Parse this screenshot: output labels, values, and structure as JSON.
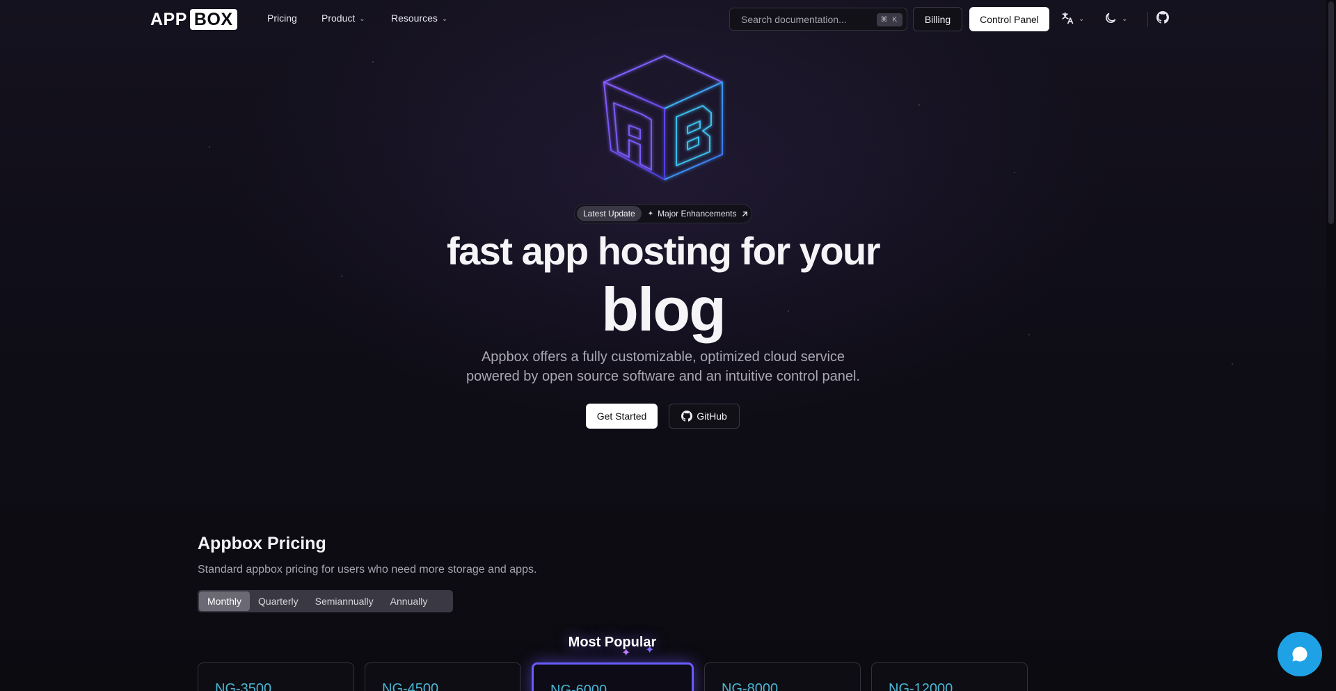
{
  "nav": {
    "logo_left": "APP",
    "logo_right": "BOX",
    "links": [
      {
        "label": "Pricing",
        "has_menu": false
      },
      {
        "label": "Product",
        "has_menu": true
      },
      {
        "label": "Resources",
        "has_menu": true
      }
    ],
    "search_placeholder": "Search documentation...",
    "search_shortcut": "⌘ K",
    "billing_label": "Billing",
    "control_panel_label": "Control Panel",
    "icons": [
      "translate-icon",
      "theme-icon",
      "github-icon"
    ]
  },
  "hero": {
    "badge_tag": "Latest Update",
    "badge_message": "Major Enhancements",
    "headline_line1": "fast app hosting for your",
    "headline_line2": "blog",
    "subtitle_line1": "Appbox offers a fully customizable, optimized cloud service",
    "subtitle_line2": "powered by open source software and an intuitive control panel.",
    "cta_primary": "Get Started",
    "cta_secondary": "GitHub"
  },
  "pricing": {
    "title": "Appbox Pricing",
    "subtitle": "Standard appbox pricing for users who need more storage and apps.",
    "periods": [
      "Monthly",
      "Quarterly",
      "Semiannually",
      "Annually"
    ],
    "active_period": "Monthly",
    "most_popular_label": "Most Popular",
    "plans": [
      "NG-3500",
      "NG-4500",
      "NG-6000",
      "NG-8000",
      "NG-12000"
    ],
    "featured_plan": "NG-6000"
  },
  "colors": {
    "background": "#0d0c12",
    "accent_cyan": "#4ab7d4",
    "accent_purple": "#6a5cff",
    "chat_button": "#1fa2e5"
  }
}
